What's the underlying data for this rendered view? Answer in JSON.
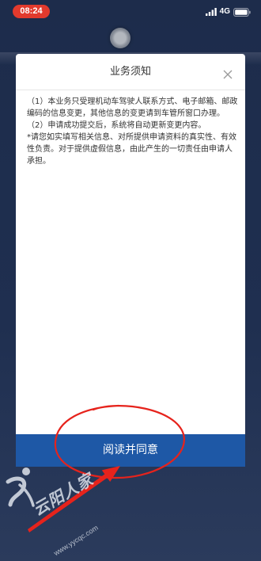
{
  "status_bar": {
    "time": "08:24",
    "network": "4G"
  },
  "dialog": {
    "title": "业务须知",
    "paragraphs": [
      "（1）本业务只受理机动车驾驶人联系方式、电子邮箱、邮政编码的信息变更，其他信息的变更请到车管所窗口办理。",
      "（2）申请成功提交后，系统将自动更新变更内容。",
      "*请您如实填写相关信息、对所提供申请资料的真实性、有效性负责。对于提供虚假信息，由此产生的一切责任由申请人承担。"
    ],
    "agree_button_label": "阅读并同意"
  },
  "watermark": {
    "brand": "云阳人家",
    "url": "www.yycqc.com"
  },
  "icons": {
    "close": "close-icon",
    "signal": "signal-bars-icon",
    "battery": "battery-icon",
    "floating_button": "assistive-touch-icon",
    "watermark_logo": "logo-icon"
  },
  "colors": {
    "accent": "#1e58a6",
    "time_badge": "#e23a2d",
    "annotation": "#e6231c",
    "background": "#1d2c4b",
    "dialog_background": "#ffffff",
    "text": "#333333"
  }
}
